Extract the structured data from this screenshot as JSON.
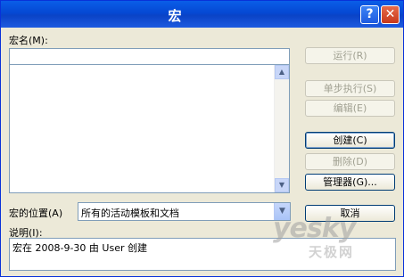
{
  "window": {
    "title": "宏",
    "help_symbol": "?",
    "close_symbol": "✕"
  },
  "macro_name": {
    "label": "宏名(M):",
    "value": ""
  },
  "macro_list": {
    "items": []
  },
  "location": {
    "label": "宏的位置(A)",
    "selected": "所有的活动模板和文档"
  },
  "description": {
    "label": "说明(I):",
    "text": "宏在 2008-9-30 由 User 创建"
  },
  "buttons": {
    "run": "运行(R)",
    "step_into": "单步执行(S)",
    "edit": "编辑(E)",
    "create": "创建(C)",
    "delete": "删除(D)",
    "organizer": "管理器(G)...",
    "cancel": "取消"
  },
  "watermark": {
    "brand": "yesky",
    "sub": "天极网"
  }
}
